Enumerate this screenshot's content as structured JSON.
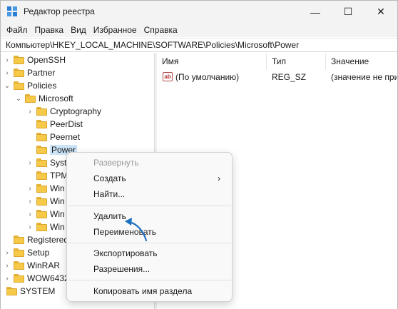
{
  "window": {
    "title": "Редактор реестра",
    "controls": {
      "minimize": "—",
      "maximize": "☐",
      "close": "✕"
    }
  },
  "menu": [
    "Файл",
    "Правка",
    "Вид",
    "Избранное",
    "Справка"
  ],
  "address": "Компьютер\\HKEY_LOCAL_MACHINE\\SOFTWARE\\Policies\\Microsoft\\Power",
  "tree": [
    {
      "label": "OpenSSH",
      "chevron": "›"
    },
    {
      "label": "Partner",
      "chevron": "›"
    },
    {
      "label": "Policies",
      "chevron": "⌄"
    },
    {
      "label": "Microsoft",
      "chevron": "⌄"
    },
    {
      "label": "Cryptography",
      "chevron": "›"
    },
    {
      "label": "PeerDist",
      "chevron": ""
    },
    {
      "label": "Peernet",
      "chevron": ""
    },
    {
      "label": "Power",
      "chevron": ""
    },
    {
      "label": "Syst",
      "chevron": "›"
    },
    {
      "label": "TPM",
      "chevron": ""
    },
    {
      "label": "Win",
      "chevron": "›"
    },
    {
      "label": "Win",
      "chevron": "›"
    },
    {
      "label": "Win",
      "chevron": "›"
    },
    {
      "label": "Win",
      "chevron": "›"
    },
    {
      "label": "Registered",
      "chevron": ""
    },
    {
      "label": "Setup",
      "chevron": "›"
    },
    {
      "label": "WinRAR",
      "chevron": "›"
    },
    {
      "label": "WOW6432",
      "chevron": "›"
    },
    {
      "label": "SYSTEM",
      "chevron": "›"
    }
  ],
  "values": {
    "columns": {
      "name": "Имя",
      "type": "Тип",
      "value": "Значение"
    },
    "rows": [
      {
        "icon": "ab",
        "name": "(По умолчанию)",
        "type": "REG_SZ",
        "value": "(значение не присвоено)"
      }
    ]
  },
  "context_menu": {
    "items": [
      {
        "label": "Развернуть",
        "disabled": true
      },
      {
        "label": "Создать",
        "arrow": "›"
      },
      {
        "label": "Найти..."
      },
      {
        "label": "Удалить"
      },
      {
        "label": "Переименовать"
      },
      {
        "label": "Экспортировать"
      },
      {
        "label": "Разрешения..."
      },
      {
        "label": "Копировать имя раздела"
      }
    ]
  },
  "colors": {
    "accent": "#2a7fd4",
    "selection": "#cce4f7",
    "folder": "#f7c948",
    "annotation_arrow": "#1f6fbf"
  }
}
